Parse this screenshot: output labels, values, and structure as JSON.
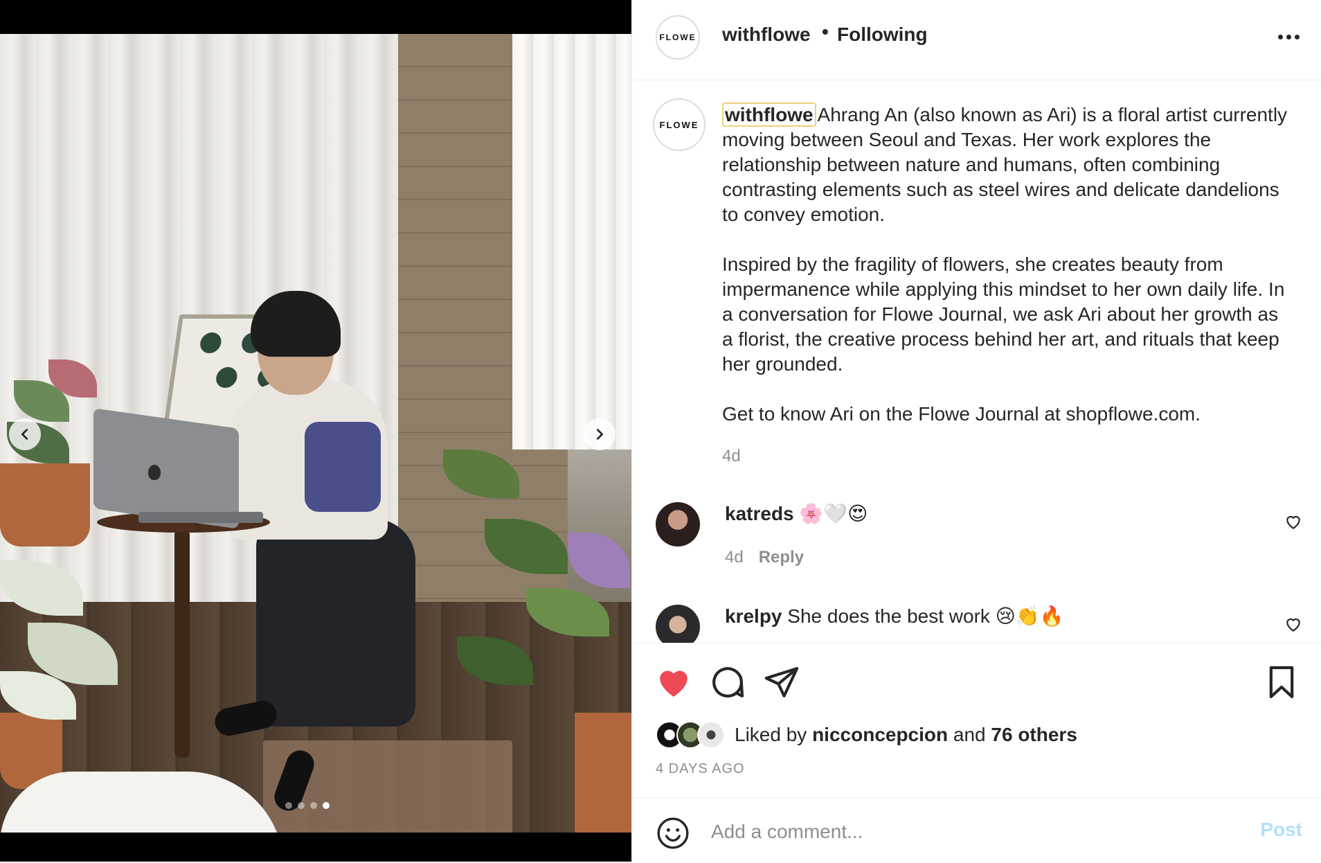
{
  "post": {
    "username": "withflowe",
    "separator": "•",
    "follow_status": "Following",
    "logo_text": "FLOWE",
    "caption_paragraphs": [
      "Ahrang An (also known as Ari) is a floral artist currently moving between Seoul and Texas. Her work explores the relationship between nature and humans, often combining contrasting elements such as steel wires and delicate dandelions to convey emotion.",
      "Inspired by the fragility of flowers, she creates beauty from impermanence while applying this mindset to her own daily life. In a conversation for Flowe Journal, we ask Ari about her growth as a florist, the creative process behind her art, and rituals that keep her grounded.",
      "Get to know Ari on the Flowe Journal at shopflowe.com."
    ],
    "caption_time": "4d"
  },
  "comments": [
    {
      "username": "katreds",
      "text": "🌸🤍😍",
      "time": "4d",
      "reply_label": "Reply"
    },
    {
      "username": "krelpy",
      "text": "She does the best work 😢👏🔥"
    }
  ],
  "likes": {
    "prefix": "Liked by",
    "user": "nicconcepcion",
    "joiner": "and",
    "others": "76 others",
    "date": "4 DAYS AGO"
  },
  "add_comment": {
    "placeholder": "Add a comment...",
    "post_label": "Post"
  },
  "carousel": {
    "slide_count": 4,
    "active_index": 3
  },
  "colors": {
    "like_red": "#ed4956",
    "post_disabled": "#b2dffc",
    "mention_highlight": "#f0cf7c"
  }
}
